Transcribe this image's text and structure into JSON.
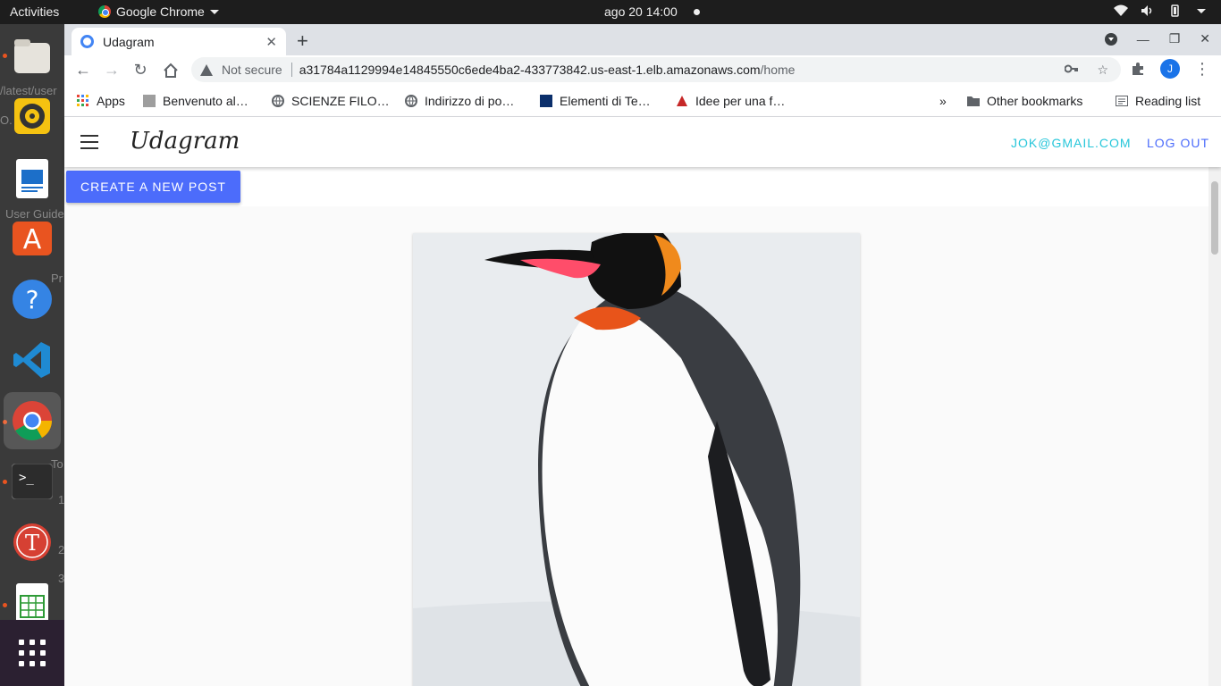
{
  "os": {
    "activities": "Activities",
    "app_name": "Google Chrome",
    "clock": "ago 20  14:00"
  },
  "dock": {
    "bg_texts": [
      "/latest/user",
      "O.",
      "User Guide",
      "Pr",
      "To",
      "1",
      "2",
      "3"
    ],
    "items": [
      "files",
      "rhythmbox",
      "libreoffice-writer",
      "ubuntu-software",
      "help",
      "vscode",
      "chrome",
      "terminal",
      "typora",
      "libreoffice-calc"
    ]
  },
  "browser": {
    "tab_title": "Udagram",
    "not_secure": "Not secure",
    "url_host": "a31784a1129994e14845550c6ede4ba2-433773842.us-east-1.elb.amazonaws.com",
    "url_path": "/home",
    "profile_initial": "J",
    "bookmarks": [
      {
        "label": "Apps"
      },
      {
        "label": "Benvenuto al…"
      },
      {
        "label": "SCIENZE FILO…"
      },
      {
        "label": "Indirizzo di po…"
      },
      {
        "label": "Elementi di Te…"
      },
      {
        "label": "Idee per una f…"
      }
    ],
    "overflow": "»",
    "other_bookmarks": "Other bookmarks",
    "reading_list": "Reading list"
  },
  "app": {
    "brand": "Udagram",
    "user_email": "JOK@GMAIL.COM",
    "logout": "LOG OUT",
    "create_post": "CREATE A NEW POST",
    "colors": {
      "accent": "#4c6cfb",
      "email": "#26c6da",
      "logout": "#4c6cfb"
    }
  }
}
